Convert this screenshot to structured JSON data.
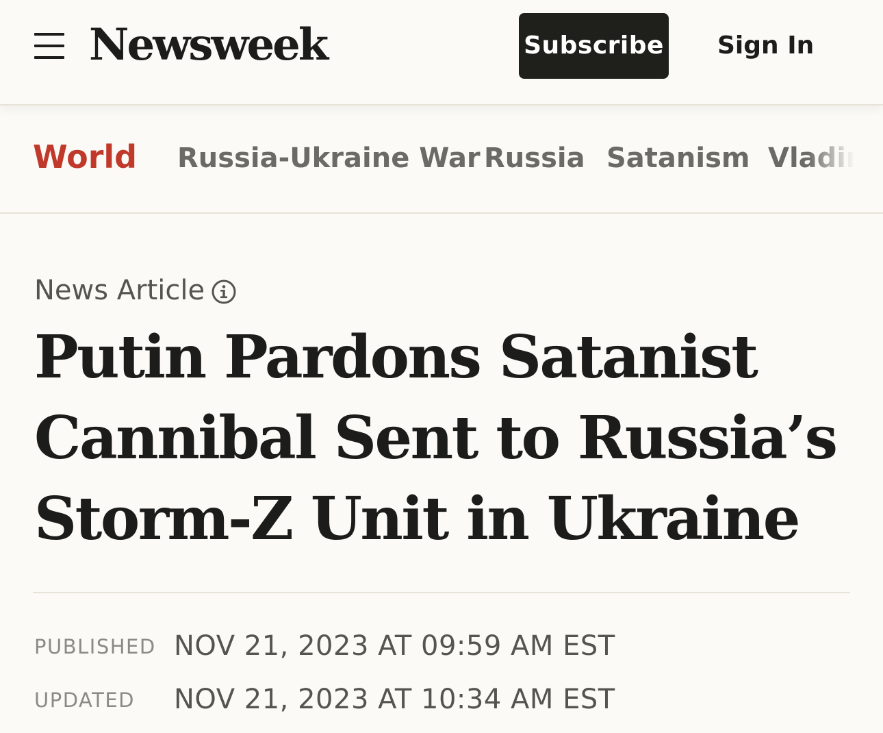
{
  "header": {
    "brand": "Newsweek",
    "subscribe_label": "Subscribe",
    "signin_label": "Sign In"
  },
  "nav": {
    "primary": "World",
    "items": [
      "Russia-Ukraine War",
      "Russia",
      "Satanism",
      "Vladir"
    ]
  },
  "article": {
    "type_label": "News Article",
    "headline": "Putin Pardons Satanist Cannibal Sent to Russia’s Storm-Z Unit in Ukraine",
    "published_label": "PUBLISHED",
    "published_value": "NOV 21, 2023 AT 09:59 AM EST",
    "updated_label": "UPDATED",
    "updated_value": "NOV 21, 2023 AT 10:34 AM EST"
  },
  "colors": {
    "accent": "#c0392b",
    "background": "#fbfaf6",
    "button": "#1f1f1c",
    "text": "#1c1c1a",
    "muted": "#6b6a66"
  },
  "icons": {
    "menu": "hamburger-menu-icon",
    "info": "info-icon"
  }
}
